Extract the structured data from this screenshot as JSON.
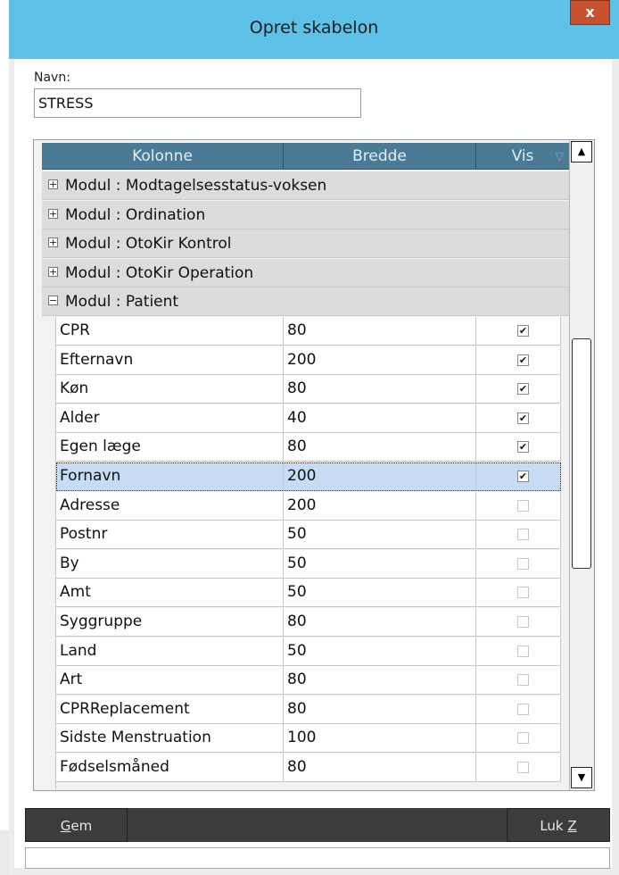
{
  "window": {
    "title": "Opret skabelon",
    "close_label": "x"
  },
  "form": {
    "navn_label": "Navn:",
    "navn_value": "STRESS"
  },
  "grid": {
    "columns": [
      "Kolonne",
      "Bredde",
      "Vis"
    ],
    "groups": [
      {
        "label": "Modul : Modtagelsesstatus-voksen",
        "expanded": false
      },
      {
        "label": "Modul : Ordination",
        "expanded": false
      },
      {
        "label": "Modul : OtoKir Kontrol",
        "expanded": false
      },
      {
        "label": "Modul : OtoKir Operation",
        "expanded": false
      },
      {
        "label": "Modul : Patient",
        "expanded": true
      }
    ],
    "rows": [
      {
        "name": "CPR",
        "width": "80",
        "vis": true
      },
      {
        "name": "Efternavn",
        "width": "200",
        "vis": true
      },
      {
        "name": "Køn",
        "width": "80",
        "vis": true
      },
      {
        "name": "Alder",
        "width": "40",
        "vis": true
      },
      {
        "name": "Egen læge",
        "width": "80",
        "vis": true
      },
      {
        "name": "Fornavn",
        "width": "200",
        "vis": true,
        "selected": true
      },
      {
        "name": "Adresse",
        "width": "200",
        "vis": false
      },
      {
        "name": "Postnr",
        "width": "50",
        "vis": false
      },
      {
        "name": "By",
        "width": "50",
        "vis": false
      },
      {
        "name": "Amt",
        "width": "50",
        "vis": false
      },
      {
        "name": "Syggruppe",
        "width": "80",
        "vis": false
      },
      {
        "name": "Land",
        "width": "50",
        "vis": false
      },
      {
        "name": "Art",
        "width": "80",
        "vis": false
      },
      {
        "name": "CPRReplacement",
        "width": "80",
        "vis": false
      },
      {
        "name": "Sidste Menstruation",
        "width": "100",
        "vis": false
      },
      {
        "name": "Fødselsmåned",
        "width": "80",
        "vis": false
      }
    ]
  },
  "buttons": {
    "gem": {
      "underline": "G",
      "rest": "em"
    },
    "luk": {
      "text": "Luk ",
      "underline": "Z"
    }
  },
  "colors": {
    "titlebar": "#5ec1e8",
    "header": "#4b7a96",
    "selection": "#c6dcf5",
    "close": "#c7502f"
  }
}
